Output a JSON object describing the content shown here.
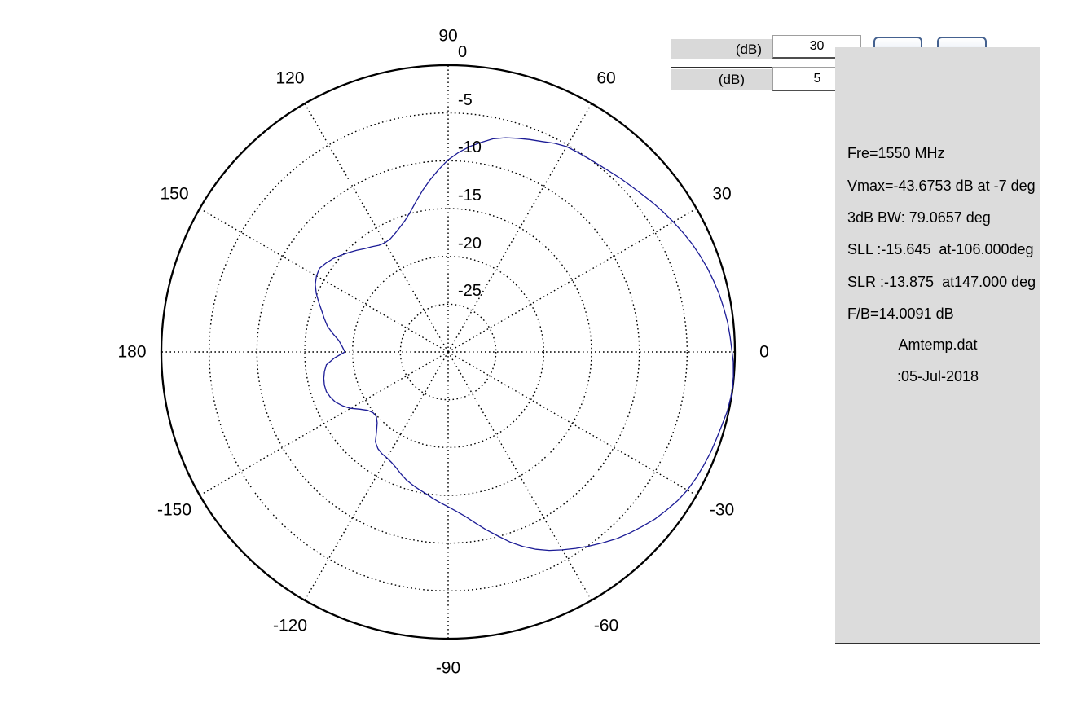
{
  "controls": {
    "range_label": "(dB)",
    "range_value": "30",
    "step_label": "(dB)",
    "step_value": "5",
    "button1_label": "",
    "button2_label": ""
  },
  "info_panel": {
    "lines": [
      "Fre=1550 MHz",
      "Vmax=-43.6753 dB at -7 deg",
      "3dB BW: 79.0657 deg",
      "SLL :-15.645  at-106.000deg",
      "SLR :-13.875  at147.000 deg",
      "F/B=14.0091 dB"
    ],
    "file_name": "Amtemp.dat",
    "file_date": ":05-Jul-2018"
  },
  "chart_data": {
    "type": "polar-line",
    "title": "",
    "units": "dB",
    "grid": true,
    "r_axis": {
      "min": -30,
      "max": 0,
      "step_db": 5,
      "tick_labels": [
        "0",
        "-5",
        "-10",
        "-15",
        "-20",
        "-25"
      ]
    },
    "angle_step_deg": 30,
    "angle_ticks_deg": [
      0,
      30,
      60,
      90,
      120,
      150,
      180,
      -150,
      -120,
      -90,
      -60,
      -30
    ],
    "colors": {
      "curve": "#1c1c96",
      "grid": "#000000"
    },
    "series": [
      {
        "name": "radiation-pattern",
        "color": "#1c1c96",
        "points_deg_db": [
          [
            -180,
            -19.2
          ],
          [
            -177,
            -18.1
          ],
          [
            -174,
            -17.2
          ],
          [
            -171,
            -16.9
          ],
          [
            -168,
            -16.7
          ],
          [
            -165,
            -16.6
          ],
          [
            -162,
            -16.6
          ],
          [
            -159,
            -16.8
          ],
          [
            -156,
            -17.1
          ],
          [
            -153,
            -17.6
          ],
          [
            -150,
            -18.2
          ],
          [
            -147,
            -19.0
          ],
          [
            -144,
            -19.6
          ],
          [
            -141,
            -19.9
          ],
          [
            -138,
            -19.9
          ],
          [
            -135,
            -19.5
          ],
          [
            -132,
            -18.8
          ],
          [
            -129,
            -17.9
          ],
          [
            -126,
            -17.5
          ],
          [
            -123,
            -17.3
          ],
          [
            -120,
            -17.2
          ],
          [
            -117,
            -17.0
          ],
          [
            -114,
            -16.7
          ],
          [
            -111,
            -16.3
          ],
          [
            -108,
            -15.9
          ],
          [
            -105,
            -15.6
          ],
          [
            -102,
            -15.3
          ],
          [
            -99,
            -15.0
          ],
          [
            -96,
            -14.6
          ],
          [
            -93,
            -14.2
          ],
          [
            -90,
            -13.8
          ],
          [
            -87,
            -13.3
          ],
          [
            -84,
            -12.7
          ],
          [
            -81,
            -11.9
          ],
          [
            -78,
            -11.0
          ],
          [
            -75,
            -10.1
          ],
          [
            -72,
            -9.1
          ],
          [
            -69,
            -8.2
          ],
          [
            -66,
            -7.4
          ],
          [
            -63,
            -6.7
          ],
          [
            -60,
            -6.1
          ],
          [
            -57,
            -5.5
          ],
          [
            -54,
            -4.9
          ],
          [
            -51,
            -4.3
          ],
          [
            -48,
            -3.7
          ],
          [
            -45,
            -3.2
          ],
          [
            -42,
            -2.7
          ],
          [
            -39,
            -2.2
          ],
          [
            -36,
            -1.8
          ],
          [
            -33,
            -1.4
          ],
          [
            -30,
            -1.1
          ],
          [
            -27,
            -0.9
          ],
          [
            -24,
            -0.75
          ],
          [
            -21,
            -0.6
          ],
          [
            -18,
            -0.5
          ],
          [
            -15,
            -0.35
          ],
          [
            -12,
            -0.15
          ],
          [
            -9,
            -0.05
          ],
          [
            -7,
            0
          ],
          [
            -5,
            -0.05
          ],
          [
            -2,
            -0.15
          ],
          [
            0,
            -0.3
          ],
          [
            3,
            -0.45
          ],
          [
            6,
            -0.6
          ],
          [
            9,
            -0.8
          ],
          [
            12,
            -1
          ],
          [
            15,
            -1.25
          ],
          [
            18,
            -1.5
          ],
          [
            21,
            -1.8
          ],
          [
            24,
            -2.1
          ],
          [
            27,
            -2.45
          ],
          [
            30,
            -2.8
          ],
          [
            33,
            -3.15
          ],
          [
            36,
            -3.5
          ],
          [
            39,
            -3.85
          ],
          [
            42,
            -4.15
          ],
          [
            45,
            -4.4
          ],
          [
            48,
            -4.65
          ],
          [
            51,
            -4.85
          ],
          [
            54,
            -5
          ],
          [
            57,
            -5.1
          ],
          [
            60,
            -5.2
          ],
          [
            63,
            -5.5
          ],
          [
            66,
            -5.9
          ],
          [
            69,
            -6.2
          ],
          [
            72,
            -6.5
          ],
          [
            75,
            -6.8
          ],
          [
            78,
            -7.2
          ],
          [
            81,
            -7.8
          ],
          [
            84,
            -8.4
          ],
          [
            87,
            -9.1
          ],
          [
            90,
            -9.9
          ],
          [
            93,
            -10.9
          ],
          [
            96,
            -11.9
          ],
          [
            99,
            -12.9
          ],
          [
            102,
            -13.9
          ],
          [
            105,
            -14.8
          ],
          [
            108,
            -15.5
          ],
          [
            111,
            -16.0
          ],
          [
            114,
            -16.4
          ],
          [
            117,
            -16.7
          ],
          [
            120,
            -16.8
          ],
          [
            123,
            -16.7
          ],
          [
            126,
            -16.4
          ],
          [
            129,
            -16.1
          ],
          [
            132,
            -15.7
          ],
          [
            135,
            -15.3
          ],
          [
            138,
            -14.9
          ],
          [
            141,
            -14.5
          ],
          [
            144,
            -14.2
          ],
          [
            147,
            -13.95
          ],
          [
            150,
            -14.1
          ],
          [
            153,
            -14.4
          ],
          [
            156,
            -14.9
          ],
          [
            159,
            -15.5
          ],
          [
            162,
            -16.1
          ],
          [
            165,
            -16.6
          ],
          [
            168,
            -17.1
          ],
          [
            171,
            -17.8
          ],
          [
            174,
            -18.5
          ],
          [
            177,
            -18.9
          ],
          [
            180,
            -19.2
          ]
        ]
      }
    ]
  }
}
